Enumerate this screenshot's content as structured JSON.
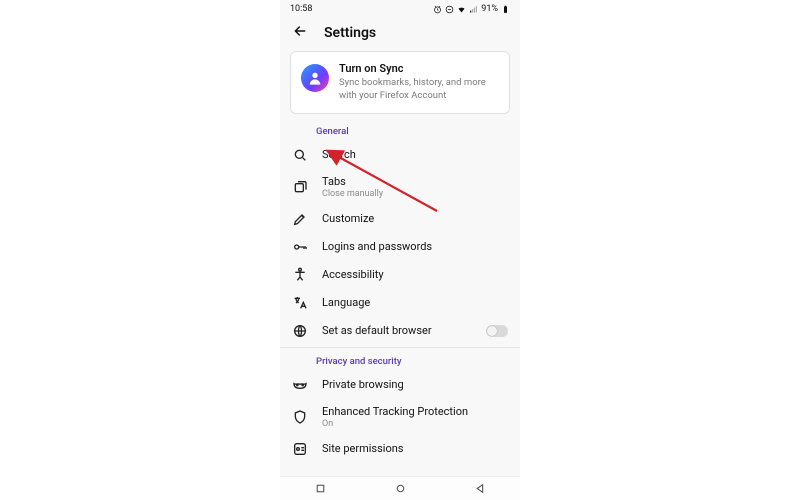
{
  "status": {
    "time": "10:58",
    "battery": "91%"
  },
  "header": {
    "title": "Settings"
  },
  "sync": {
    "title": "Turn on Sync",
    "subtitle": "Sync bookmarks, history, and more with your Firefox Account"
  },
  "sections": {
    "general_label": "General",
    "privacy_label": "Privacy and security"
  },
  "rows": {
    "search": {
      "label": "Search"
    },
    "tabs": {
      "label": "Tabs",
      "sub": "Close manually"
    },
    "customize": {
      "label": "Customize"
    },
    "logins": {
      "label": "Logins and passwords"
    },
    "accessibility": {
      "label": "Accessibility"
    },
    "language": {
      "label": "Language"
    },
    "default_browser": {
      "label": "Set as default browser"
    },
    "private_browsing": {
      "label": "Private browsing"
    },
    "etp": {
      "label": "Enhanced Tracking Protection",
      "sub": "On"
    },
    "site_permissions": {
      "label": "Site permissions"
    }
  }
}
